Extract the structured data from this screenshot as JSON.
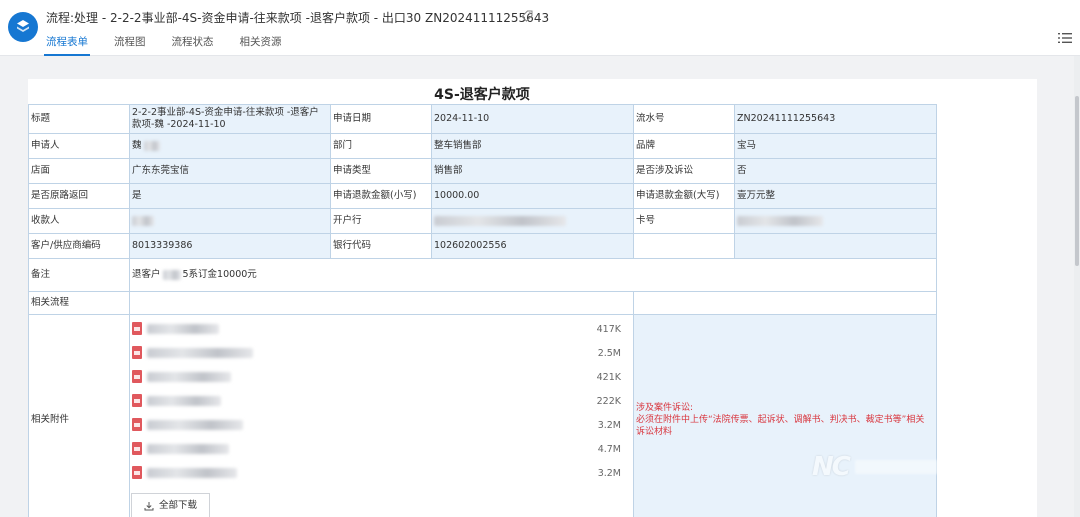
{
  "header": {
    "title": "流程:处理 - 2-2-2事业部-4S-资金申请-往来款项 -退客户款项 - 出口30 ZN20241111255643",
    "tabs": [
      {
        "label": "流程表单",
        "active": true
      },
      {
        "label": "流程图",
        "active": false
      },
      {
        "label": "流程状态",
        "active": false
      },
      {
        "label": "相关资源",
        "active": false
      }
    ],
    "accent": "#1677d2"
  },
  "form": {
    "title": "4S-退客户款项",
    "labels": {
      "subject": "标题",
      "apply_date": "申请日期",
      "serial_no": "流水号",
      "applicant": "申请人",
      "department": "部门",
      "brand": "品牌",
      "store": "店面",
      "apply_type": "申请类型",
      "litigation": "是否涉及诉讼",
      "return_original": "是否原路返回",
      "amount_lower": "申请退款金额(小写)",
      "amount_upper": "申请退款金额(大写)",
      "payee": "收款人",
      "bank": "开户行",
      "card_no": "卡号",
      "supplier_code": "客户/供应商编码",
      "bank_code": "银行代码",
      "remark": "备注",
      "related_flow": "相关流程",
      "attachments": "相关附件"
    },
    "values": {
      "subject": "2-2-2事业部-4S-资金申请-往来款项 -退客户款项-魏 -2024-11-10",
      "apply_date": "2024-11-10",
      "serial_no": "ZN20241111255643",
      "applicant": "魏",
      "department": "整车销售部",
      "brand": "宝马",
      "store": "广东东莞宝信",
      "apply_type": "销售部",
      "litigation": "否",
      "return_original": "是",
      "amount_lower": "10000.00",
      "amount_upper": "壹万元整",
      "payee": "",
      "bank": "",
      "card_no": "",
      "supplier_code": "8013339386",
      "bank_code": "102602002556",
      "remark_prefix": "退客户",
      "remark_suffix": "5系订金10000元"
    },
    "attachments": [
      {
        "size": "417K"
      },
      {
        "size": "2.5M"
      },
      {
        "size": "421K"
      },
      {
        "size": "222K"
      },
      {
        "size": "3.2M"
      },
      {
        "size": "4.7M"
      },
      {
        "size": "3.2M"
      }
    ],
    "download_all_label": "全部下载",
    "lawsuit_note": "涉及案件诉讼:\n必须在附件中上传“法院传票、起诉状、调解书、判决书、裁定书等”相关诉讼材料",
    "lawsuit_color": "#d9363e"
  },
  "watermark": {
    "logo_text": "NC"
  }
}
